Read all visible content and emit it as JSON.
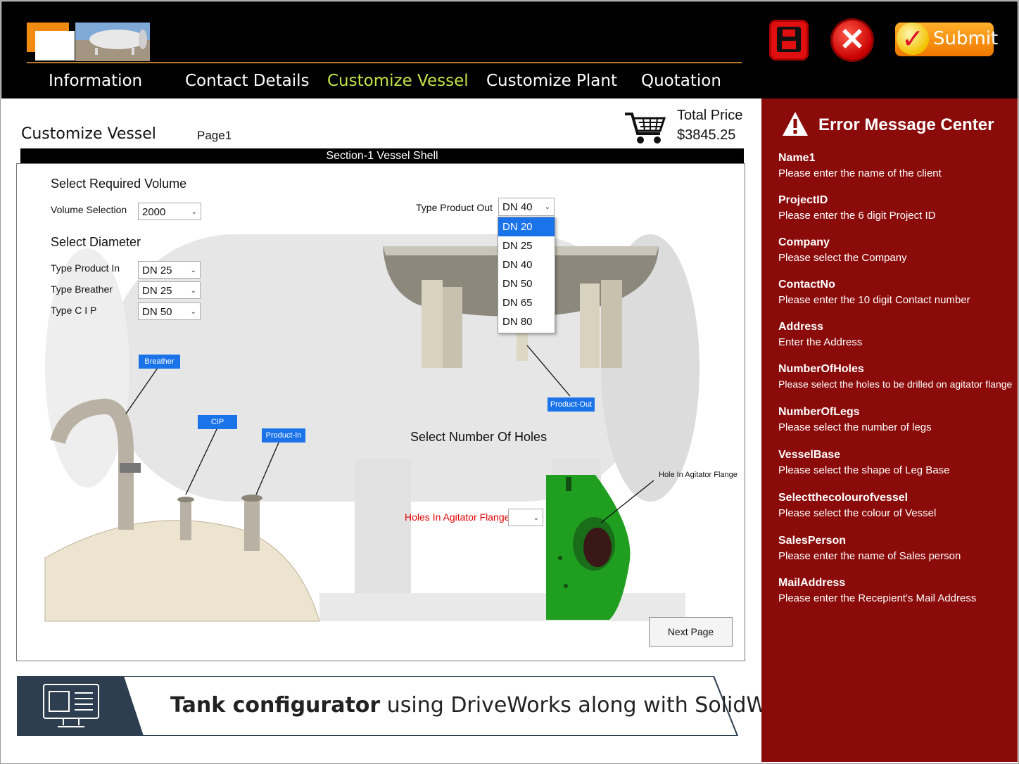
{
  "nav": {
    "tabs": [
      "Information",
      "Contact Details",
      "Customize Vessel",
      "Customize Plant",
      "Quotation"
    ],
    "active": "Customize Vessel"
  },
  "toolbar": {
    "submit_label": "Submit"
  },
  "page": {
    "title": "Customize Vessel",
    "page_label": "Page1"
  },
  "price": {
    "label": "Total Price",
    "value": "$3845.25"
  },
  "section": {
    "title": "Section-1 Vessel Shell"
  },
  "volume": {
    "heading": "Select Required Volume",
    "label": "Volume Selection",
    "value": "2000"
  },
  "diameter": {
    "heading": "Select Diameter",
    "rows": [
      {
        "label": "Type Product In",
        "value": "DN 25"
      },
      {
        "label": "Type Breather",
        "value": "DN 25"
      },
      {
        "label": "Type C I P",
        "value": "DN 50"
      }
    ]
  },
  "product_out": {
    "label": "Type Product Out",
    "value": "DN 40",
    "options": [
      "DN 20",
      "DN 25",
      "DN 40",
      "DN 50",
      "DN 65",
      "DN 80"
    ],
    "highlighted": "DN 20"
  },
  "callouts": {
    "breather": "Breather",
    "cip": "CIP",
    "product_in": "Product-In",
    "product_out": "Product-Out"
  },
  "holes": {
    "heading": "Select Number Of Holes",
    "label": "Holes In Agitator Flange",
    "value": "",
    "annotation": "Hole In Agitator Flange"
  },
  "next_button": "Next Page",
  "footer": {
    "bold": "Tank configurator",
    "rest": "using DriveWorks along with SolidWorks"
  },
  "errors": {
    "title": "Error Message Center",
    "items": [
      {
        "name": "Name1",
        "message": "Please enter the name of the client"
      },
      {
        "name": "ProjectID",
        "message": "Please enter the 6 digit Project ID"
      },
      {
        "name": "Company",
        "message": "Please select the Company"
      },
      {
        "name": "ContactNo",
        "message": "Please enter the 10 digit Contact number"
      },
      {
        "name": "Address",
        "message": "Enter the Address"
      },
      {
        "name": "NumberOfHoles",
        "message": "Please select the holes to be drilled on agitator flange"
      },
      {
        "name": "NumberOfLegs",
        "message": "Please select the number of legs"
      },
      {
        "name": "VesselBase",
        "message": "Please select the shape of Leg Base"
      },
      {
        "name": "Selectthecolourofvessel",
        "message": "Please select the colour of Vessel"
      },
      {
        "name": "SalesPerson",
        "message": "Please enter the name of Sales person"
      },
      {
        "name": "MailAddress",
        "message": "Please enter the Recepient's Mail Address"
      }
    ]
  },
  "colors": {
    "active_tab": "#c6e24a",
    "error_panel": "#8b0a0a",
    "accent": "#1a73e8",
    "holes_label": "#e00000"
  }
}
